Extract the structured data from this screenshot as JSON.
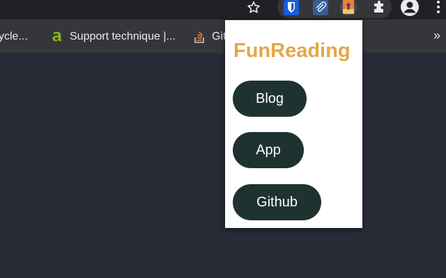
{
  "toolbar": {
    "icons": [
      "star-icon",
      "bitwarden-icon",
      "paperclip-icon",
      "funreading-icon",
      "puzzle-icon",
      "account-icon",
      "menu-icon"
    ]
  },
  "bookmarks": {
    "items": [
      {
        "label": "ycle...",
        "icon": "none"
      },
      {
        "label": "Support technique |...",
        "icon": "acer-icon"
      },
      {
        "label": "Git",
        "icon": "stackoverflow-icon"
      }
    ],
    "overflow": "»"
  },
  "popup": {
    "title": "FunReading",
    "buttons": {
      "blog": "Blog",
      "app": "App",
      "github": "Github"
    }
  },
  "colors": {
    "page_bg": "#282a36",
    "title": "#e5a64a",
    "button_bg": "#1e3330"
  }
}
